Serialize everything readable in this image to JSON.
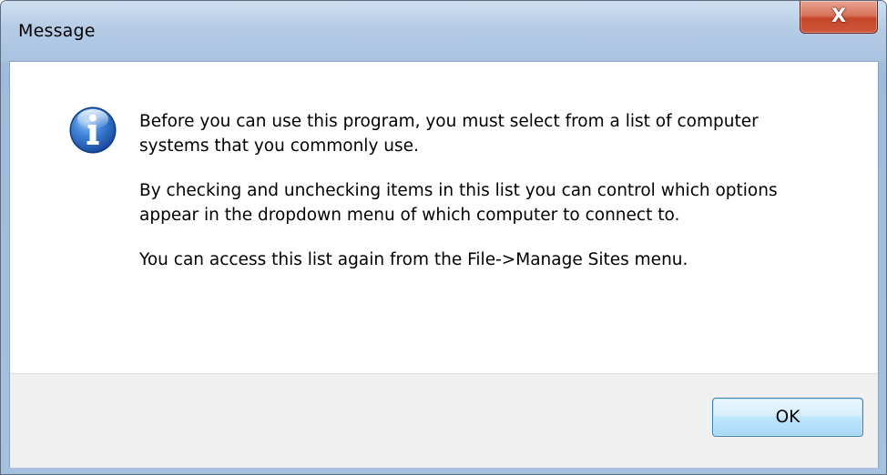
{
  "window": {
    "title": "Message",
    "close_glyph": "X"
  },
  "dialog": {
    "icon": "information-icon",
    "paragraphs": [
      "Before you can use this program, you must select from a list of computer systems that you commonly use.",
      "By checking and unchecking items in this list you can control which options appear in the dropdown menu of which computer to connect to.",
      "You can access this list again from the File->Manage Sites menu."
    ]
  },
  "buttons": {
    "ok_label": "OK"
  },
  "colors": {
    "titlebar": "#a9c3e0",
    "close_button": "#c7462b",
    "footer": "#f0f0f0",
    "ok_button_border": "#3c7fb1",
    "info_icon": "#2a66c2"
  }
}
